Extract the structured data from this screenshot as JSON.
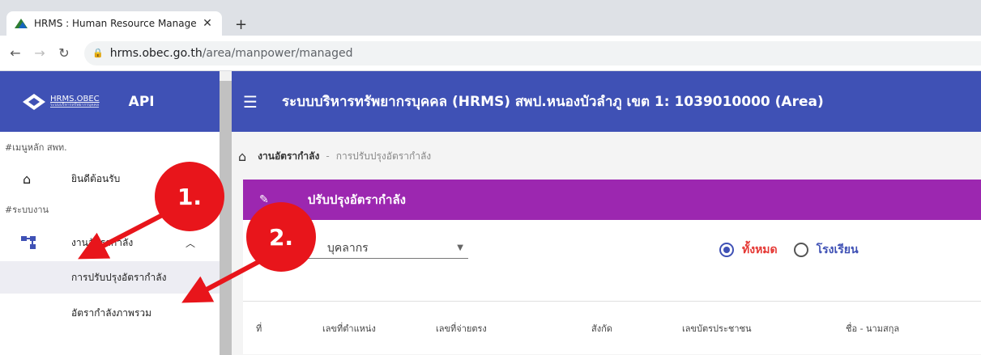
{
  "browser": {
    "tab_title": "HRMS : Human Resource Manage",
    "url_host": "hrms.obec.go.th",
    "url_path": "/area/manpower/managed"
  },
  "sidebar": {
    "logo_text": "HRMS.OBEC",
    "logo_sub": "ระบบบริหารทรัพยากรบุคคล",
    "api_label": "API",
    "section_main": "#เมนูหลัก สพท.",
    "welcome": "ยินดีต้อนรับ",
    "section_system": "#ระบบงาน",
    "manpower": "งานอัตรากำลัง",
    "adjust": "การปรับปรุงอัตรากำลัง",
    "overview": "อัตรากำลังภาพรวม"
  },
  "header": {
    "title": "ระบบบริหารทรัพยากรบุคคล (HRMS) สพป.หนองบัวลำภู เขต 1: 1039010000 (Area)"
  },
  "breadcrumb": {
    "parent": "งานอัตรากำลัง",
    "separator": "-",
    "current": "การปรับปรุงอัตรากำลัง"
  },
  "card": {
    "title": "ปรับปรุงอัตรากำลัง",
    "select_value": "บุคลากร",
    "radio_all": "ทั้งหมด",
    "radio_school": "โรงเรียน",
    "columns": [
      "ที่",
      "เลขที่ตำแหน่ง",
      "เลขที่จ่ายตรง",
      "สังกัด",
      "เลขบัตรประชาชน",
      "ชื่อ - นามสกุล"
    ]
  },
  "annotations": {
    "marker_1": "1.",
    "marker_2": "2."
  },
  "colors": {
    "header": "#3f51b5",
    "card_header": "#9c27b0",
    "annotation": "#e8151b"
  }
}
